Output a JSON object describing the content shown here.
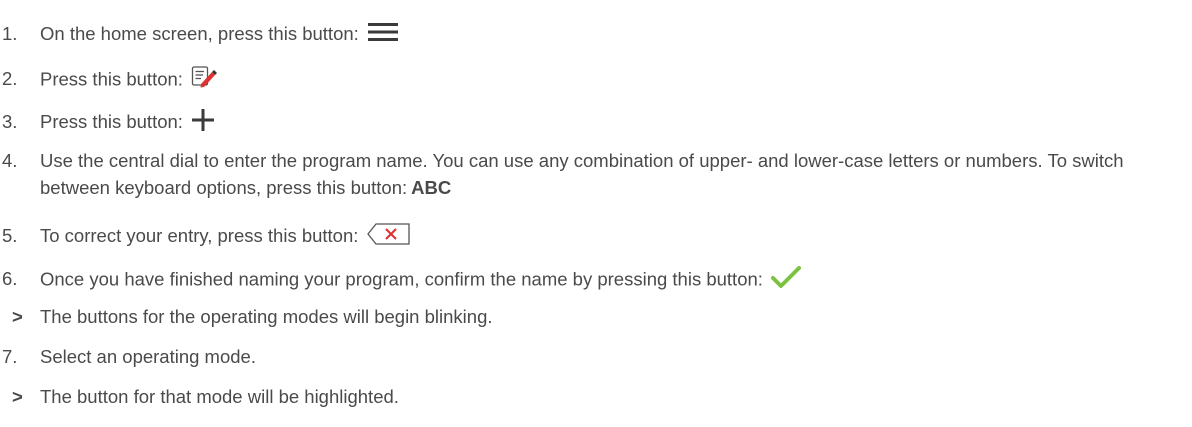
{
  "steps": [
    {
      "marker": "1.",
      "text": "On the home screen, press this button:",
      "icon": "hamburger-menu-icon"
    },
    {
      "marker": "2.",
      "text": "Press this button:",
      "icon": "edit-note-icon"
    },
    {
      "marker": "3.",
      "text": "Press this button:",
      "icon": "plus-icon"
    },
    {
      "marker": "4.",
      "text": "Use the central dial to enter the program name. You can use any combination of upper- and lower-case letters or numbers. To switch between keyboard options, press this button:",
      "button_label": "ABC"
    },
    {
      "marker": "5.",
      "text": "To correct your entry, press this button:",
      "icon": "backspace-delete-icon"
    },
    {
      "marker": "6.",
      "text": "Once you have finished naming your program, confirm the name by pressing this button:",
      "icon": "checkmark-icon"
    },
    {
      "marker": ">",
      "text": "The buttons for the operating modes will begin blinking."
    },
    {
      "marker": "7.",
      "text": "Select an operating mode."
    },
    {
      "marker": ">",
      "text": "The button for that mode will be highlighted."
    }
  ],
  "colors": {
    "text": "#4a4a4a",
    "accent_red": "#e03030",
    "check_green": "#7cc242"
  }
}
